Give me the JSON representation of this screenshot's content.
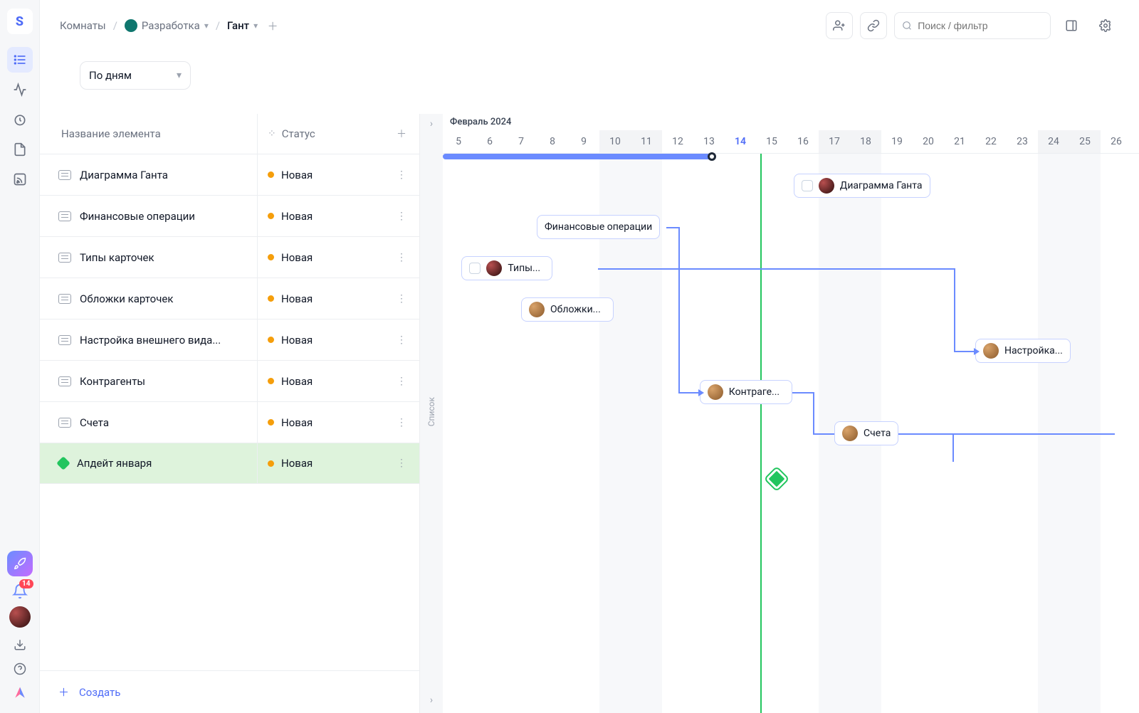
{
  "sidebar": {
    "badge_count": "14"
  },
  "breadcrumb": {
    "rooms": "Комнаты",
    "room": "Разработка",
    "view": "Гант"
  },
  "search": {
    "placeholder": "Поиск / фильтр"
  },
  "zoom": {
    "label": "По дням"
  },
  "list": {
    "col_name": "Название элемента",
    "col_status": "Статус",
    "create": "Создать",
    "handle_label": "Список",
    "rows": [
      {
        "name": "Диаграмма Ганта",
        "status": "Новая",
        "type": "card"
      },
      {
        "name": "Финансовые операции",
        "status": "Новая",
        "type": "card"
      },
      {
        "name": "Типы карточек",
        "status": "Новая",
        "type": "card"
      },
      {
        "name": "Обложки карточек",
        "status": "Новая",
        "type": "card"
      },
      {
        "name": "Настройка внешнего вида...",
        "status": "Новая",
        "type": "card"
      },
      {
        "name": "Контрагенты",
        "status": "Новая",
        "type": "card"
      },
      {
        "name": "Счета",
        "status": "Новая",
        "type": "card"
      },
      {
        "name": "Апдейт января",
        "status": "Новая",
        "type": "milestone",
        "highlight": true
      }
    ]
  },
  "gantt": {
    "month": "Февраль 2024",
    "days": [
      5,
      6,
      7,
      8,
      9,
      10,
      11,
      12,
      13,
      14,
      15,
      16,
      17,
      18,
      19,
      20,
      21,
      22,
      23,
      24,
      25,
      26
    ],
    "today": 14,
    "weekends": [
      10,
      11,
      17,
      18,
      24,
      25
    ],
    "tasks": {
      "t0": "Диаграмма Ганта",
      "t1": "Финансовые операции",
      "t2": "Типы...",
      "t3": "Обложки...",
      "t4": "Настройка...",
      "t5": "Контраге...",
      "t6": "Счета"
    }
  }
}
